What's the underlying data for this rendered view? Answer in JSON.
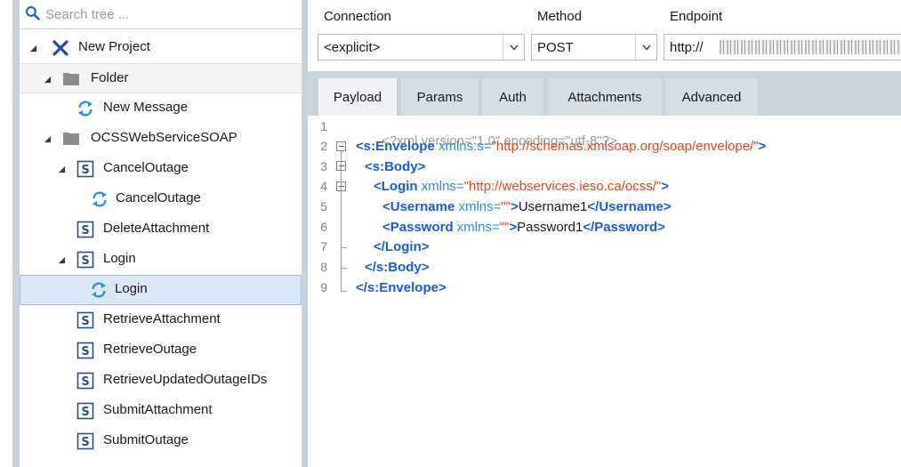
{
  "tree": {
    "search_placeholder": "Search tree ...",
    "nodes": [
      {
        "label": "New Project",
        "icon": "project-icon"
      },
      {
        "label": "Folder",
        "icon": "folder-icon"
      },
      {
        "label": "New Message",
        "icon": "refresh-message-icon"
      },
      {
        "label": "OCSSWebServiceSOAP",
        "icon": "folder-icon"
      },
      {
        "label": "CancelOutage",
        "icon": "soap-operation-icon"
      },
      {
        "label": "CancelOutage",
        "icon": "refresh-message-icon"
      },
      {
        "label": "DeleteAttachment",
        "icon": "soap-operation-icon"
      },
      {
        "label": "Login",
        "icon": "soap-operation-icon"
      },
      {
        "label": "Login",
        "icon": "refresh-message-icon"
      },
      {
        "label": "RetrieveAttachment",
        "icon": "soap-operation-icon"
      },
      {
        "label": "RetrieveOutage",
        "icon": "soap-operation-icon"
      },
      {
        "label": "RetrieveUpdatedOutageIDs",
        "icon": "soap-operation-icon"
      },
      {
        "label": "SubmitAttachment",
        "icon": "soap-operation-icon"
      },
      {
        "label": "SubmitOutage",
        "icon": "soap-operation-icon"
      }
    ]
  },
  "request": {
    "connection_label": "Connection",
    "method_label": "Method",
    "endpoint_label": "Endpoint",
    "connection_value": "<explicit>",
    "method_value": "POST",
    "endpoint_value": "http://"
  },
  "tabs": [
    "Payload",
    "Params",
    "Auth",
    "Attachments",
    "Advanced"
  ],
  "active_tab": "Payload",
  "editor": {
    "line_numbers": [
      "1",
      "2",
      "3",
      "4",
      "5",
      "6",
      "7",
      "8",
      "9"
    ],
    "xml_decl": "<?xml version=\"1.0\" encoding=\"utf-8\"?>",
    "envelope_open_tag": "<s:Envelope",
    "envelope_attr": " xmlns:s=",
    "envelope_val": "\"http://schemas.xmlsoap.org/soap/envelope/\"",
    "close_bracket": ">",
    "body_open": "<s:Body>",
    "login_open_tag": "<Login",
    "login_attr": " xmlns=",
    "login_val": "\"http://webservices.ieso.ca/ocss/\"",
    "username_open_tag": "<Username",
    "empty_xmlns_attr": " xmlns=",
    "empty_val": "\"\"",
    "username_text": "Username1",
    "username_close": "</Username>",
    "password_open_tag": "<Password",
    "password_text": "Password1",
    "password_close": "</Password>",
    "login_close": "</Login>",
    "body_close": "</s:Body>",
    "envelope_close": "</s:Envelope>"
  },
  "colors": {
    "tag": "#1a5bd6",
    "attribute": "#2b8fd6",
    "value": "#e0491e",
    "panel_bg": "#c9d2db",
    "selection": "#dce8f6"
  }
}
